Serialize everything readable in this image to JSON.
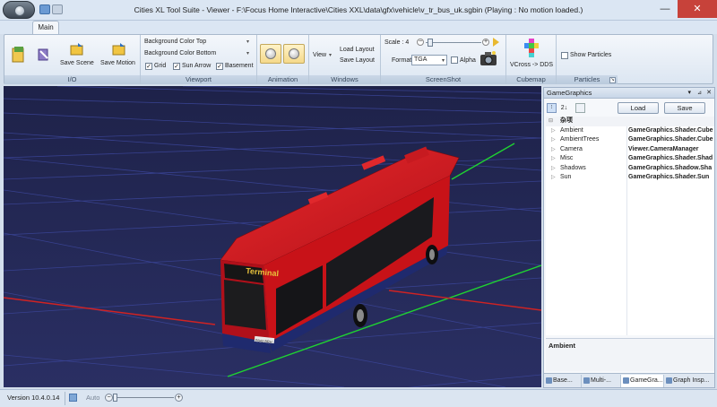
{
  "window": {
    "title": "Cities XL Tool Suite - Viewer - F:\\Focus Home Interactive\\Cities XXL\\data\\gfx\\vehicle\\v_tr_bus_uk.sgbin (Playing : No motion loaded.)",
    "minimize": "—",
    "maximize": "☐",
    "close": "✕"
  },
  "tabs": {
    "main": "Main"
  },
  "ribbon": {
    "io": {
      "label": "I/O",
      "save_scene": "Save Scene",
      "save_motion": "Save Motion"
    },
    "viewport": {
      "label": "Viewport",
      "bg_top": "Background Color Top",
      "bg_bottom": "Background Color Bottom",
      "grid": "Grid",
      "sun_arrow": "Sun Arrow",
      "basement": "Basement"
    },
    "animation": {
      "label": "Animation"
    },
    "windows": {
      "label": "Windows",
      "view": "View",
      "load_layout": "Load Layout",
      "save_layout": "Save Layout"
    },
    "screenshot": {
      "label": "ScreenShot",
      "scale_label": "Scale : 4",
      "format_label": "Format",
      "format_value": "TGA",
      "alpha": "Alpha"
    },
    "cubemap": {
      "label": "Cubemap",
      "vcross": "VCross -> DDS"
    },
    "particles": {
      "label": "Particles",
      "show": "Show Particles"
    }
  },
  "viewport": {
    "bus_sign": "Terminal",
    "plate": "P843 BRH",
    "colors": {
      "background": "#232753",
      "grid": "#3d4aa0",
      "body": "#d4131b",
      "skirt": "#1f2a6e"
    }
  },
  "panel": {
    "title": "GameGraphics",
    "pin": "📌",
    "close": "✕",
    "dropdown": "▾",
    "load": "Load",
    "save": "Save",
    "category": "杂项",
    "rows": [
      {
        "key": "Ambient",
        "value": "GameGraphics.Shader.Cube"
      },
      {
        "key": "AmbientTrees",
        "value": "GameGraphics.Shader.Cube"
      },
      {
        "key": "Camera",
        "value": "Viewer.CameraManager"
      },
      {
        "key": "Misc",
        "value": "GameGraphics.Shader.Shad"
      },
      {
        "key": "Shadows",
        "value": "GameGraphics.Shadow.Sha"
      },
      {
        "key": "Sun",
        "value": "GameGraphics.Shader.Sun"
      }
    ],
    "description_title": "Ambient",
    "tabs": [
      "Base...",
      "Multi-...",
      "GameGra...",
      "Graph Insp..."
    ]
  },
  "status": {
    "version": "Version 10.4.0.14",
    "auto": "Auto"
  }
}
